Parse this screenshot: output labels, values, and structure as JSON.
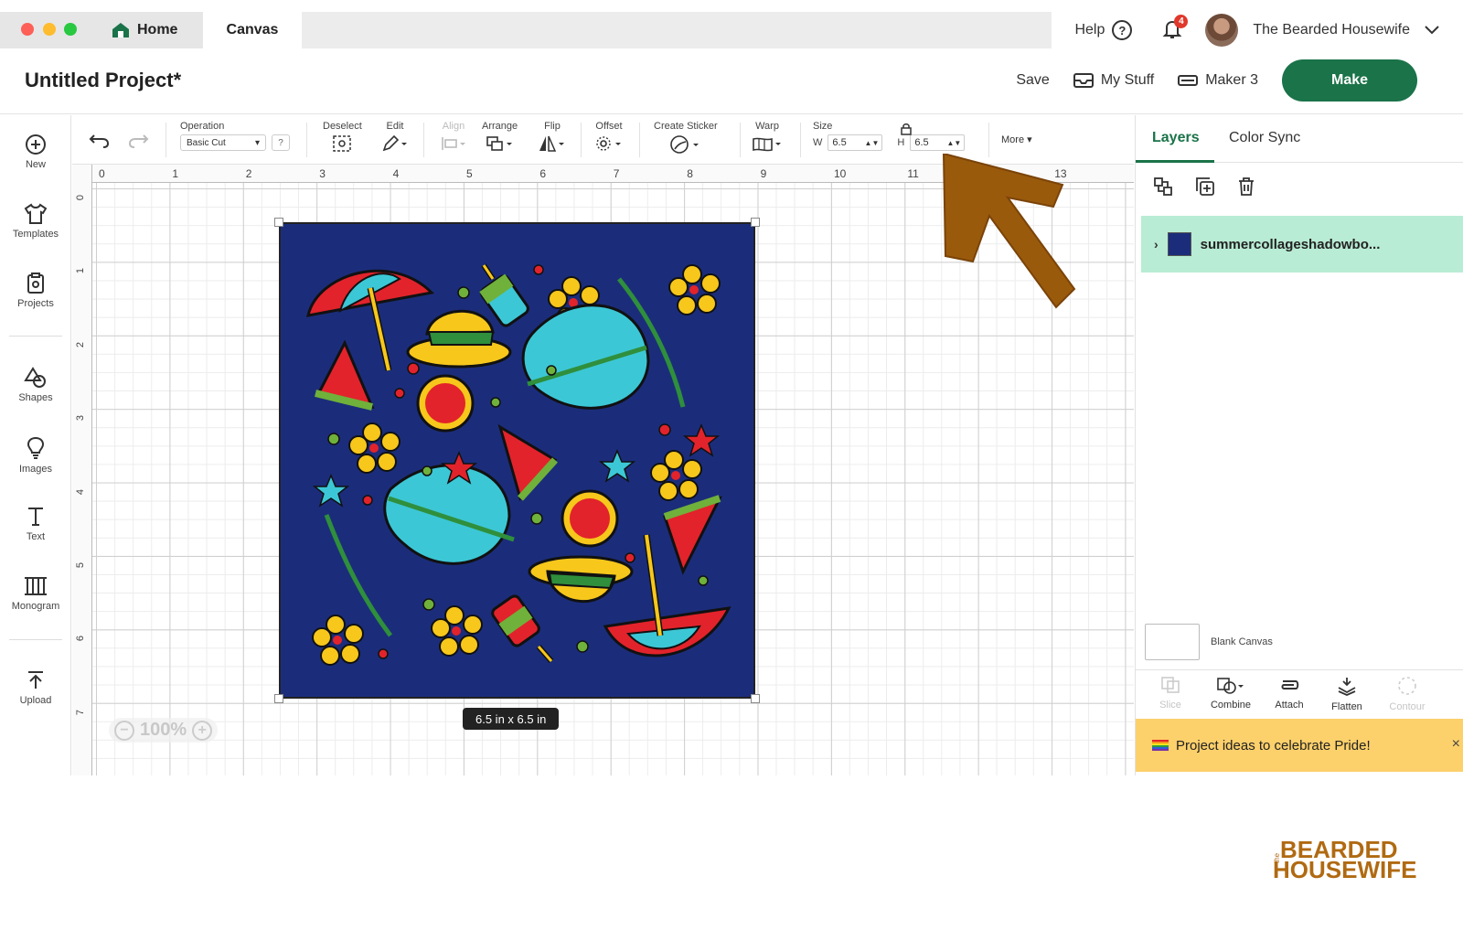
{
  "titlebar": {
    "tabs": [
      {
        "label": "Home"
      },
      {
        "label": "Canvas"
      }
    ],
    "help_label": "Help",
    "notification_count": "4",
    "user_name": "The Bearded Housewife"
  },
  "project": {
    "title": "Untitled Project*",
    "save_label": "Save",
    "my_stuff_label": "My Stuff",
    "machine_label": "Maker 3",
    "make_label": "Make"
  },
  "leftnav": {
    "items": [
      {
        "label": "New",
        "icon": "plus-circle-icon"
      },
      {
        "label": "Templates",
        "icon": "shirt-icon"
      },
      {
        "label": "Projects",
        "icon": "projects-icon"
      },
      {
        "label": "Shapes",
        "icon": "shapes-icon"
      },
      {
        "label": "Images",
        "icon": "lightbulb-icon"
      },
      {
        "label": "Text",
        "icon": "text-icon"
      },
      {
        "label": "Monogram",
        "icon": "monogram-icon"
      },
      {
        "label": "Upload",
        "icon": "upload-icon"
      }
    ]
  },
  "toolbar": {
    "operation_label": "Operation",
    "operation_value": "Basic Cut",
    "operation_help": "?",
    "deselect_label": "Deselect",
    "edit_label": "Edit",
    "align_label": "Align",
    "arrange_label": "Arrange",
    "flip_label": "Flip",
    "offset_label": "Offset",
    "create_sticker_label": "Create Sticker",
    "warp_label": "Warp",
    "size_label": "Size",
    "width_prefix": "W",
    "width_value": "6.5",
    "height_prefix": "H",
    "height_value": "6.5",
    "more_label": "More"
  },
  "canvas": {
    "ruler_top": [
      "0",
      "1",
      "2",
      "3",
      "4",
      "5",
      "6",
      "7",
      "8",
      "9",
      "10",
      "11",
      "13"
    ],
    "ruler_left": [
      "0",
      "1",
      "2",
      "3",
      "4",
      "5",
      "6",
      "7"
    ],
    "size_badge": "6.5  in x 6.5  in",
    "zoom_level": "100%",
    "design_background": "#1b2d7a"
  },
  "rightpanel": {
    "tabs": [
      {
        "label": "Layers",
        "active": true
      },
      {
        "label": "Color Sync",
        "active": false
      }
    ],
    "layer_name": "summercollageshadowbo...",
    "blank_canvas_label": "Blank Canvas",
    "actions": [
      {
        "label": "Slice",
        "enabled": false
      },
      {
        "label": "Combine",
        "enabled": true
      },
      {
        "label": "Attach",
        "enabled": true
      },
      {
        "label": "Flatten",
        "enabled": true
      },
      {
        "label": "Contour",
        "enabled": false
      }
    ],
    "promo_text": "Project ideas to celebrate Pride!",
    "promo_close": "×"
  },
  "brand": {
    "top": "BEARDED",
    "small": "the",
    "bottom": "HOUSEWIFE"
  },
  "colors": {
    "accent_green": "#1a7349",
    "layer_highlight": "#b8ecd4",
    "promo_yellow": "#fcd06b",
    "arrow_brown": "#9a5a0c"
  }
}
